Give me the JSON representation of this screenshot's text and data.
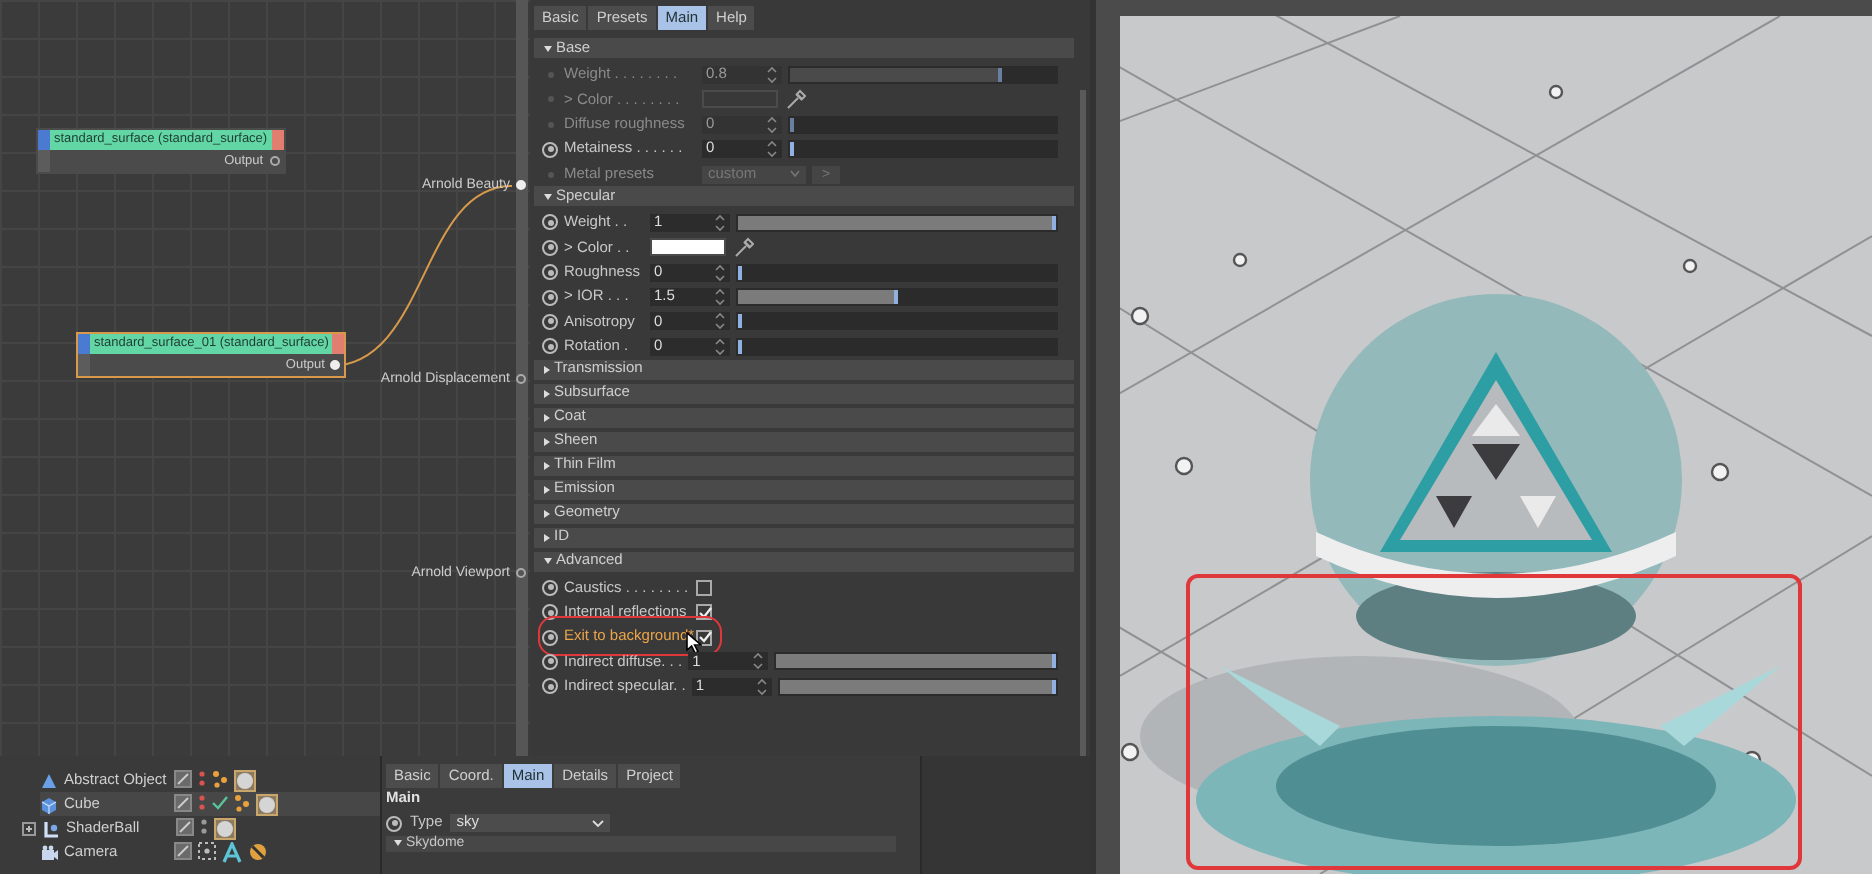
{
  "node_editor": {
    "nodes": [
      {
        "title": "standard_surface (standard_surface)",
        "port": "Output",
        "selected": false,
        "connected": false
      },
      {
        "title": "standard_surface_01 (standard_surface)",
        "port": "Output",
        "selected": true,
        "connected": true
      }
    ],
    "output_ports": [
      {
        "label": "Arnold Beauty",
        "connected": true
      },
      {
        "label": "Arnold Displacement",
        "connected": false
      },
      {
        "label": "Arnold Viewport",
        "connected": false
      }
    ]
  },
  "material_editor": {
    "tabs": [
      {
        "label": "Basic",
        "selected": false
      },
      {
        "label": "Presets",
        "selected": false
      },
      {
        "label": "Main",
        "selected": true
      },
      {
        "label": "Help",
        "selected": false
      }
    ],
    "sections": [
      {
        "title": "Base",
        "expanded": true,
        "rows": [
          {
            "kind": "slider",
            "label": "Weight . . . . . . . .",
            "value": "0.8",
            "level": 0.8,
            "disabled": true
          },
          {
            "kind": "color",
            "label": "Color . . . . . . . .",
            "expander": ">",
            "disabled": true
          },
          {
            "kind": "slider",
            "label": "Diffuse roughness",
            "value": "0",
            "level": 0,
            "disabled": true
          },
          {
            "kind": "slider",
            "label": "Metainess . . . . . .",
            "value": "0",
            "level": 0,
            "disabled": false
          },
          {
            "kind": "dropdown",
            "label": "Metal presets",
            "value": "custom",
            "button": ">",
            "disabled": true
          }
        ]
      },
      {
        "title": "Specular",
        "expanded": true,
        "rows": [
          {
            "kind": "slider",
            "label": "Weight . .",
            "value": "1",
            "level": 1,
            "disabled": false
          },
          {
            "kind": "color",
            "label": "Color . .",
            "expander": ">",
            "color": "#ffffff",
            "disabled": false
          },
          {
            "kind": "slider",
            "label": "Roughness",
            "value": "0",
            "level": 0,
            "disabled": false
          },
          {
            "kind": "slider",
            "label": "IOR . . .",
            "expander": ">",
            "value": "1.5",
            "level": 0.5,
            "disabled": false
          },
          {
            "kind": "slider",
            "label": "Anisotropy",
            "value": "0",
            "level": 0,
            "disabled": false
          },
          {
            "kind": "slider",
            "label": "Rotation .",
            "value": "0",
            "level": 0,
            "disabled": false
          }
        ]
      },
      {
        "title": "Transmission",
        "expanded": false
      },
      {
        "title": "Subsurface",
        "expanded": false
      },
      {
        "title": "Coat",
        "expanded": false
      },
      {
        "title": "Sheen",
        "expanded": false
      },
      {
        "title": "Thin Film",
        "expanded": false
      },
      {
        "title": "Emission",
        "expanded": false
      },
      {
        "title": "Geometry",
        "expanded": false
      },
      {
        "title": "ID",
        "expanded": false
      },
      {
        "title": "Advanced",
        "expanded": true,
        "rows": [
          {
            "kind": "checkbox",
            "label": "Caustics . . . . . . . .",
            "checked": false,
            "highlighted": false
          },
          {
            "kind": "checkbox",
            "label": "Internal reflections",
            "checked": true,
            "highlighted": false
          },
          {
            "kind": "checkbox",
            "label": "Exit to background*",
            "checked": true,
            "highlighted": true
          },
          {
            "kind": "slider",
            "label": "Indirect diffuse. . .",
            "value": "1",
            "level": 1,
            "disabled": false
          },
          {
            "kind": "slider",
            "label": "Indirect specular. .",
            "value": "1",
            "level": 1,
            "disabled": false
          }
        ]
      }
    ]
  },
  "object_manager": {
    "objects": [
      {
        "name": "Abstract Object",
        "kind": "abstract",
        "selected": false,
        "expandable": false,
        "tags": [
          {
            "kind": "layer"
          },
          {
            "kind": "vis"
          },
          {
            "kind": "phong"
          },
          {
            "kind": "material"
          }
        ]
      },
      {
        "name": "Cube",
        "kind": "cube",
        "selected": true,
        "expandable": false,
        "tags": [
          {
            "kind": "layer"
          },
          {
            "kind": "vis"
          },
          {
            "kind": "check"
          },
          {
            "kind": "phong"
          },
          {
            "kind": "material"
          }
        ]
      },
      {
        "name": "ShaderBall",
        "kind": "shaderball",
        "selected": false,
        "expandable": true,
        "tags": [
          {
            "kind": "layer"
          },
          {
            "kind": "visoff"
          },
          {
            "kind": "material"
          }
        ]
      },
      {
        "name": "Camera",
        "kind": "camera",
        "selected": false,
        "expandable": false,
        "tags": [
          {
            "kind": "layer"
          },
          {
            "kind": "camvis"
          },
          {
            "kind": "target"
          },
          {
            "kind": "protection"
          }
        ]
      }
    ]
  },
  "sky_attributes": {
    "tabs": [
      {
        "label": "Basic",
        "selected": false
      },
      {
        "label": "Coord.",
        "selected": false
      },
      {
        "label": "Main",
        "selected": true
      },
      {
        "label": "Details",
        "selected": false
      },
      {
        "label": "Project",
        "selected": false
      }
    ],
    "heading": "Main",
    "fields": [
      {
        "label": "Type",
        "value": "sky"
      }
    ],
    "section": {
      "title": "Skydome",
      "expanded": true
    }
  },
  "render_view": {
    "kind": "picture",
    "annotation_frame": true
  }
}
